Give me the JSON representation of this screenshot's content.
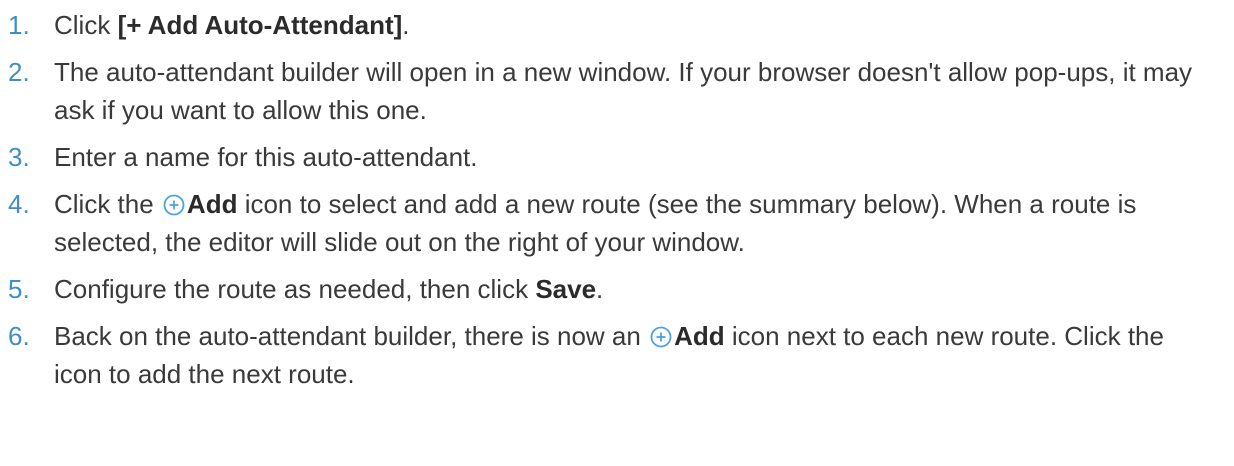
{
  "steps": [
    {
      "number": "1.",
      "pre": "Click ",
      "bold": "[+ Add Auto-Attendant]",
      "post": "."
    },
    {
      "number": "2.",
      "text": "The auto-attendant builder will open in a new window. If your browser doesn't allow pop-ups, it may ask if you want to allow this one."
    },
    {
      "number": "3.",
      "text": "Enter a name for this auto-attendant."
    },
    {
      "number": "4.",
      "pre": "Click the ",
      "icon": "plus-circle-icon",
      "bold": "Add",
      "post": " icon to select and add a new route (see the summary below). When a route is selected, the editor will slide out on the right of your window."
    },
    {
      "number": "5.",
      "pre": "Configure the route as needed, then click ",
      "bold": "Save",
      "post": "."
    },
    {
      "number": "6.",
      "pre": "Back on the auto-attendant builder, there is now an ",
      "icon": "plus-circle-icon",
      "bold": "Add",
      "post": " icon next to each new route. Click the icon to add the next route."
    }
  ],
  "colors": {
    "number": "#3d8fc8",
    "icon": "#4aa3df",
    "text": "#3a3a3a"
  }
}
